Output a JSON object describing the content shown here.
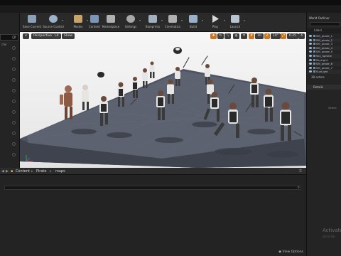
{
  "toolbar": {
    "buttons": [
      {
        "label": "Save Current",
        "icon": "save-icon",
        "color": "#8aa0b8"
      },
      {
        "label": "Source Control",
        "icon": "source-control-icon",
        "color": "#9bb2c8"
      },
      {
        "label": "Modes",
        "icon": "modes-icon",
        "color": "#c8a46b"
      },
      {
        "label": "Content",
        "icon": "content-icon",
        "color": "#7a95b8"
      },
      {
        "label": "Marketplace",
        "icon": "marketplace-icon",
        "color": "#b0b0b0"
      },
      {
        "label": "Settings",
        "icon": "gear-icon",
        "color": "#a8a8a8"
      },
      {
        "label": "Blueprints",
        "icon": "blueprints-icon",
        "color": "#a0b0c0"
      },
      {
        "label": "Cinematics",
        "icon": "cinematics-icon",
        "color": "#b0b0b0"
      },
      {
        "label": "Build",
        "icon": "build-icon",
        "color": "#9ab0c8"
      },
      {
        "label": "Play",
        "icon": "play-icon",
        "color": "#d8d8d8"
      },
      {
        "label": "Launch",
        "icon": "launch-icon",
        "color": "#b8c4d0"
      }
    ]
  },
  "viewport": {
    "perspective": "Perspective",
    "lit": "Lit",
    "show": "Show",
    "grid_snap": "10",
    "rotation_snap": "10°",
    "scale_snap": "0.25",
    "camera_speed": "4"
  },
  "left_panel": {
    "labels": [
      "cter"
    ]
  },
  "content_browser": {
    "breadcrumbs": [
      "Content",
      "Pirate",
      "maps"
    ],
    "view_options": "View Options"
  },
  "world_outliner": {
    "title": "World Outliner",
    "column_label": "Label",
    "rows": [
      "SM_pirate_1",
      "SM_pirate_2",
      "SM_pirate_3",
      "SM_pirate_4",
      "SM_pirate_5",
      "Sky_Sphere",
      "SkyLight",
      "SM_pirate_6",
      "SM_pirate_7",
      "SunLight"
    ],
    "actors_count": "38 actors"
  },
  "details": {
    "tab_label": "Details",
    "select_hint": "Select"
  },
  "watermark": {
    "line1": "Activate",
    "line2": "Go to Se"
  },
  "colors": {
    "accent": "#c8751f",
    "floor": "#5a5f6c"
  }
}
